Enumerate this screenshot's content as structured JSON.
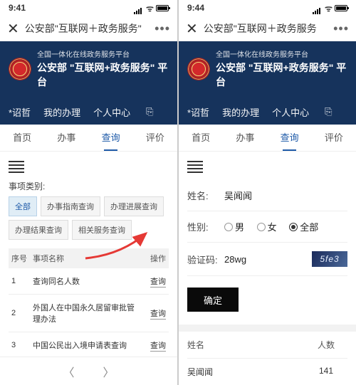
{
  "left": {
    "status_time": "9:41",
    "nav_title": "公安部\"互联网＋政务服务\"",
    "platform_sub": "全国一体化在线政务服务平台",
    "platform_title": "公安部 \"互联网+政务服务\" 平台",
    "user_name": "*诏哲",
    "user_tabs": {
      "t1": "我的办理",
      "t2": "个人中心"
    },
    "main_tabs": [
      "首页",
      "办事",
      "查询",
      "评价"
    ],
    "active_tab_index": 2,
    "category_label": "事项类别:",
    "chips": [
      "全部",
      "办事指南查询",
      "办理进展查询",
      "办理结果查询",
      "相关服务查询"
    ],
    "selected_chip_index": 0,
    "table_headers": {
      "idx": "序号",
      "name": "事项名称",
      "act": "操作"
    },
    "rows": [
      {
        "idx": "1",
        "name": "查询同名人数",
        "act": "查询"
      },
      {
        "idx": "2",
        "name": "外国人在中国永久居留审批管理办法",
        "act": "查询"
      },
      {
        "idx": "3",
        "name": "中国公民出入境申请表查询",
        "act": "查询"
      }
    ]
  },
  "right": {
    "status_time": "9:44",
    "nav_title": "公安部\"互联网＋政务服务",
    "platform_sub": "全国一体化在线政务服务平台",
    "platform_title": "公安部 \"互联网+政务服务\" 平台",
    "user_name": "*诏哲",
    "user_tabs": {
      "t1": "我的办理",
      "t2": "个人中心"
    },
    "main_tabs": [
      "首页",
      "办事",
      "查询",
      "评价"
    ],
    "active_tab_index": 2,
    "form": {
      "name_label": "姓名:",
      "name_value": "吴闻闻",
      "gender_label": "性别:",
      "gender_options": [
        "男",
        "女",
        "全部"
      ],
      "gender_selected_index": 2,
      "captcha_label": "验证码:",
      "captcha_value": "28wg",
      "captcha_img": "5fe3",
      "submit": "确定"
    },
    "result": {
      "headers": {
        "c1": "姓名",
        "c2": "人数"
      },
      "rows": [
        {
          "c1": "吴闻闻",
          "c2": "141"
        }
      ]
    }
  }
}
